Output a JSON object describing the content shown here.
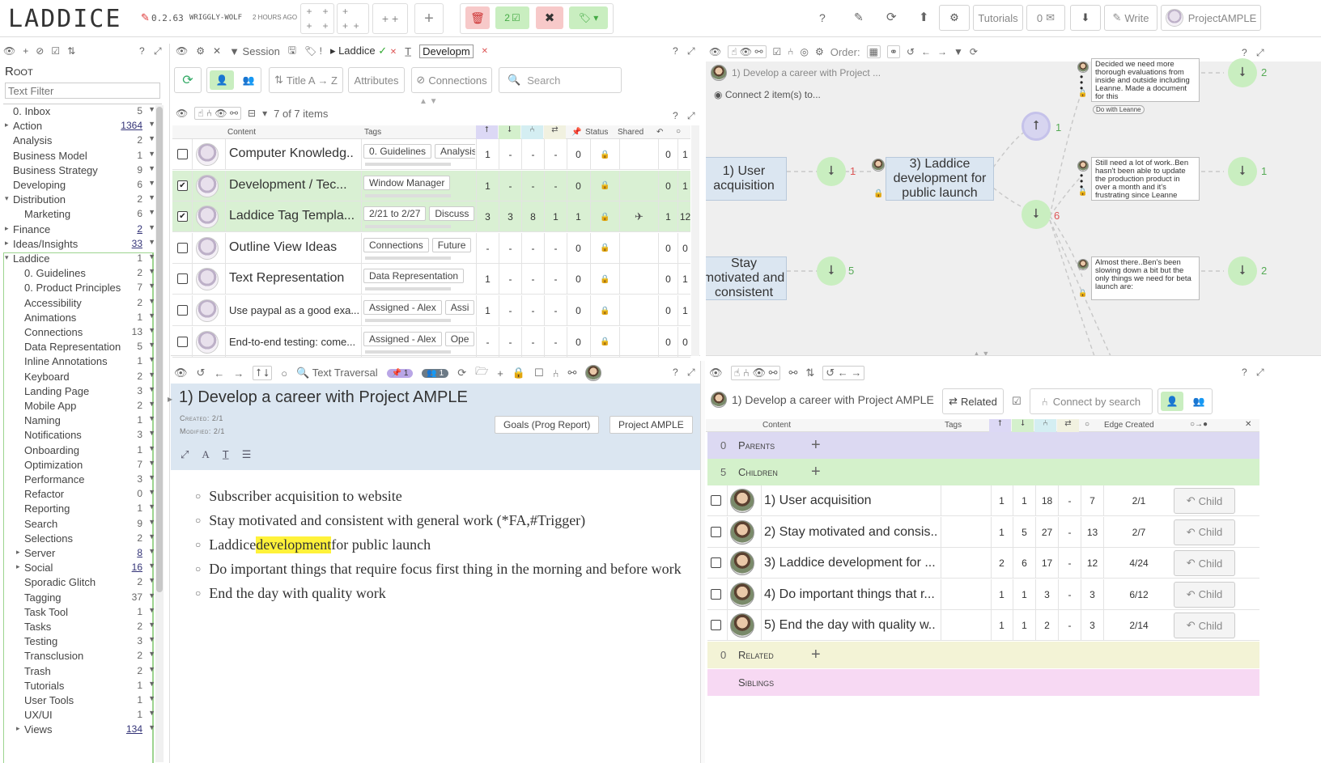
{
  "app": {
    "logo": "LADDICE",
    "version": "0.2.63",
    "codename": "WRIGGLY-WOLF",
    "updated": "2 HOURS AGO"
  },
  "topbar": {
    "select_count": "2",
    "tutorials": "Tutorials",
    "inbox_count": "0",
    "write": "Write",
    "project": "ProjectAMPLE",
    "help": "?"
  },
  "tree": {
    "root": "Root",
    "filter_placeholder": "Text Filter",
    "items": [
      {
        "label": "0. Inbox",
        "count": "5",
        "indent": 0,
        "arrow": ""
      },
      {
        "label": "Action",
        "count": "1364",
        "indent": 0,
        "arrow": "▸",
        "u": true
      },
      {
        "label": "Analysis",
        "count": "2",
        "indent": 0,
        "arrow": ""
      },
      {
        "label": "Business Model",
        "count": "1",
        "indent": 0,
        "arrow": ""
      },
      {
        "label": "Business Strategy",
        "count": "9",
        "indent": 0,
        "arrow": ""
      },
      {
        "label": "Developing",
        "count": "6",
        "indent": 0,
        "arrow": ""
      },
      {
        "label": "Distribution",
        "count": "2",
        "indent": 0,
        "arrow": "▾"
      },
      {
        "label": "Marketing",
        "count": "6",
        "indent": 1,
        "arrow": ""
      },
      {
        "label": "Finance",
        "count": "2",
        "indent": 0,
        "arrow": "▸",
        "u": true
      },
      {
        "label": "Ideas/Insights",
        "count": "33",
        "indent": 0,
        "arrow": "▸",
        "u": true
      },
      {
        "label": "Laddice",
        "count": "1",
        "indent": 0,
        "arrow": "▾"
      },
      {
        "label": "0. Guidelines",
        "count": "2",
        "indent": 1,
        "arrow": ""
      },
      {
        "label": "0. Product Principles",
        "count": "7",
        "indent": 1,
        "arrow": ""
      },
      {
        "label": "Accessibility",
        "count": "2",
        "indent": 1,
        "arrow": ""
      },
      {
        "label": "Animations",
        "count": "1",
        "indent": 1,
        "arrow": ""
      },
      {
        "label": "Connections",
        "count": "13",
        "indent": 1,
        "arrow": ""
      },
      {
        "label": "Data Representation",
        "count": "5",
        "indent": 1,
        "arrow": ""
      },
      {
        "label": "Inline Annotations",
        "count": "1",
        "indent": 1,
        "arrow": ""
      },
      {
        "label": "Keyboard",
        "count": "2",
        "indent": 1,
        "arrow": ""
      },
      {
        "label": "Landing Page",
        "count": "3",
        "indent": 1,
        "arrow": ""
      },
      {
        "label": "Mobile App",
        "count": "2",
        "indent": 1,
        "arrow": ""
      },
      {
        "label": "Naming",
        "count": "1",
        "indent": 1,
        "arrow": ""
      },
      {
        "label": "Notifications",
        "count": "3",
        "indent": 1,
        "arrow": ""
      },
      {
        "label": "Onboarding",
        "count": "1",
        "indent": 1,
        "arrow": ""
      },
      {
        "label": "Optimization",
        "count": "7",
        "indent": 1,
        "arrow": ""
      },
      {
        "label": "Performance",
        "count": "3",
        "indent": 1,
        "arrow": ""
      },
      {
        "label": "Refactor",
        "count": "0",
        "indent": 1,
        "arrow": ""
      },
      {
        "label": "Reporting",
        "count": "1",
        "indent": 1,
        "arrow": ""
      },
      {
        "label": "Search",
        "count": "9",
        "indent": 1,
        "arrow": ""
      },
      {
        "label": "Selections",
        "count": "2",
        "indent": 1,
        "arrow": ""
      },
      {
        "label": "Server",
        "count": "8",
        "indent": 1,
        "arrow": "▸",
        "u": true
      },
      {
        "label": "Social",
        "count": "16",
        "indent": 1,
        "arrow": "▸",
        "u": true
      },
      {
        "label": "Sporadic Glitch",
        "count": "2",
        "indent": 1,
        "arrow": ""
      },
      {
        "label": "Tagging",
        "count": "37",
        "indent": 1,
        "arrow": ""
      },
      {
        "label": "Task Tool",
        "count": "1",
        "indent": 1,
        "arrow": ""
      },
      {
        "label": "Tasks",
        "count": "2",
        "indent": 1,
        "arrow": ""
      },
      {
        "label": "Testing",
        "count": "3",
        "indent": 1,
        "arrow": ""
      },
      {
        "label": "Transclusion",
        "count": "2",
        "indent": 1,
        "arrow": ""
      },
      {
        "label": "Trash",
        "count": "2",
        "indent": 1,
        "arrow": ""
      },
      {
        "label": "Tutorials",
        "count": "1",
        "indent": 1,
        "arrow": ""
      },
      {
        "label": "User Tools",
        "count": "1",
        "indent": 1,
        "arrow": ""
      },
      {
        "label": "UX/UI",
        "count": "1",
        "indent": 1,
        "arrow": ""
      },
      {
        "label": "Views",
        "count": "134",
        "indent": 1,
        "arrow": "▸",
        "u": true
      }
    ]
  },
  "list_panel": {
    "session": "Session",
    "crumb": "Laddice",
    "filter_value": "Developm",
    "sort": "Title A → Z",
    "attributes": "Attributes",
    "connections": "Connections",
    "search": "Search",
    "items_count": "7 of 7 items",
    "headers": {
      "content": "Content",
      "tags": "Tags",
      "status": "Status",
      "shared": "Shared"
    },
    "rows": [
      {
        "title": "Computer Knowledg..",
        "tags": [
          "0. Guidelines",
          "Analysis"
        ],
        "checked": false,
        "green": false,
        "v": [
          "1",
          "-",
          "-",
          "-",
          "0"
        ],
        "shared": "",
        "a": "0",
        "b": "1",
        "small": false
      },
      {
        "title": "Development / Tec...",
        "tags": [
          "Window Manager"
        ],
        "checked": true,
        "green": true,
        "v": [
          "1",
          "-",
          "-",
          "-",
          "0"
        ],
        "shared": "",
        "a": "0",
        "b": "1",
        "small": false
      },
      {
        "title": "Laddice Tag Templa...",
        "tags": [
          "2/21 to 2/27",
          "Discuss"
        ],
        "checked": true,
        "green": true,
        "v": [
          "3",
          "3",
          "8",
          "1",
          "1"
        ],
        "shared": "✈",
        "a": "1",
        "b": "12",
        "small": false
      },
      {
        "title": "Outline View Ideas",
        "tags": [
          "Connections",
          "Future"
        ],
        "checked": false,
        "green": false,
        "v": [
          "-",
          "-",
          "-",
          "-",
          "0"
        ],
        "shared": "",
        "a": "0",
        "b": "0",
        "small": false
      },
      {
        "title": "Text Representation",
        "tags": [
          "Data Representation"
        ],
        "checked": false,
        "green": false,
        "v": [
          "1",
          "-",
          "-",
          "-",
          "0"
        ],
        "shared": "",
        "a": "0",
        "b": "1",
        "small": false
      },
      {
        "title": "Use paypal as a good exa...",
        "tags": [
          "Assigned - Alex",
          "Assi"
        ],
        "checked": false,
        "green": false,
        "v": [
          "1",
          "-",
          "-",
          "-",
          "0"
        ],
        "shared": "",
        "a": "0",
        "b": "1",
        "small": true
      },
      {
        "title": "End-to-end testing: come...",
        "tags": [
          "Assigned - Alex",
          "Ope"
        ],
        "checked": false,
        "green": false,
        "v": [
          "-",
          "-",
          "-",
          "-",
          "0"
        ],
        "shared": "",
        "a": "0",
        "b": "0",
        "small": true
      }
    ]
  },
  "graph_panel": {
    "order": "Order:",
    "title": "1) Develop a career with Project ...",
    "connect": "Connect 2 item(s) to...",
    "node_user": "1) User acquisition",
    "node_laddice": "3) Laddice development for public launch",
    "node_stay": "Stay motivated and consistent",
    "num_up": "1",
    "num_left": "1",
    "num_mid": "6",
    "num_five": "5",
    "num_r1": "2",
    "num_r2": "1",
    "num_r3": "2",
    "note1": "Decided we need more thorough evaluations from inside and outside including Leanne. Made a document for this",
    "note1_tag": "Do with Leanne",
    "note2": "Still need a lot of work..Ben hasn't been able to update the production product in over a month and it's frustrating since Leanne",
    "note3": "Almost there..Ben's been slowing down a bit but the only things we need for beta launch are:"
  },
  "text_panel": {
    "traversal": "Text Traversal",
    "badge1": "1",
    "badge2": "1",
    "title": "1) Develop a career with Project AMPLE",
    "created": "Created: 2/1",
    "modified": "Modified: 2/1",
    "tag1": "Goals (Prog Report)",
    "tag2": "Project AMPLE",
    "bullets": [
      {
        "pre": "Subscriber acquisition to website",
        "hl": "",
        "post": ""
      },
      {
        "pre": "Stay motivated and consistent with general work (*FA,#Trigger)",
        "hl": "",
        "post": ""
      },
      {
        "pre": "Laddice ",
        "hl": "development",
        "post": " for public launch"
      },
      {
        "pre": "Do important things that require focus first thing in the morning and before work",
        "hl": "",
        "post": ""
      },
      {
        "pre": "End the day with quality work",
        "hl": "",
        "post": ""
      }
    ]
  },
  "related_panel": {
    "title": "1) Develop a career with Project AMPLE",
    "related_btn": "Related",
    "connect": "Connect by search",
    "headers": {
      "content": "Content",
      "tags": "Tags",
      "edge": "Edge Created"
    },
    "parents": {
      "count": "0",
      "label": "Parents"
    },
    "children": {
      "count": "5",
      "label": "Children"
    },
    "related": {
      "count": "0",
      "label": "Related"
    },
    "siblings": {
      "label": "Siblings"
    },
    "rows": [
      {
        "title": "1) User acquisition",
        "v": [
          "1",
          "1",
          "18",
          "-",
          "7"
        ],
        "date": "2/1",
        "btn": "Child"
      },
      {
        "title": "2) Stay motivated and consis..",
        "v": [
          "1",
          "5",
          "27",
          "-",
          "13"
        ],
        "date": "2/7",
        "btn": "Child"
      },
      {
        "title": "3) Laddice development for ...",
        "v": [
          "2",
          "6",
          "17",
          "-",
          "12"
        ],
        "date": "4/24",
        "btn": "Child"
      },
      {
        "title": "4) Do important things that r...",
        "v": [
          "1",
          "1",
          "3",
          "-",
          "3"
        ],
        "date": "6/12",
        "btn": "Child"
      },
      {
        "title": "5) End the day with quality w..",
        "v": [
          "1",
          "1",
          "2",
          "-",
          "3"
        ],
        "date": "2/14",
        "btn": "Child"
      }
    ]
  }
}
